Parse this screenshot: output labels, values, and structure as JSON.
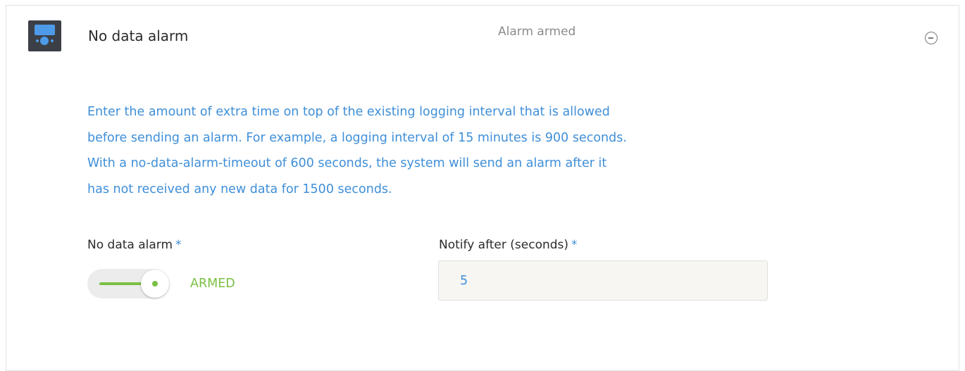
{
  "alarm": {
    "title": "No data alarm",
    "status": "Alarm armed",
    "icon": "device-icon",
    "collapse_icon": "minus-circle-icon",
    "description": "Enter the amount of extra time on top of the existing logging interval that is allowed before sending an alarm. For example, a logging interval of 15 minutes is 900 seconds. With a no-data-alarm-timeout of 600 seconds, the system will send an alarm after it has not received any new data for 1500 seconds."
  },
  "fields": {
    "toggle": {
      "label": "No data alarm",
      "required_mark": "*",
      "state_label": "ARMED",
      "checked": true
    },
    "notify": {
      "label": "Notify after (seconds)",
      "required_mark": "*",
      "value": "5"
    }
  },
  "colors": {
    "accent_blue": "#3f8fd8",
    "armed_green": "#7bc043",
    "icon_bg": "#3c3f46"
  }
}
